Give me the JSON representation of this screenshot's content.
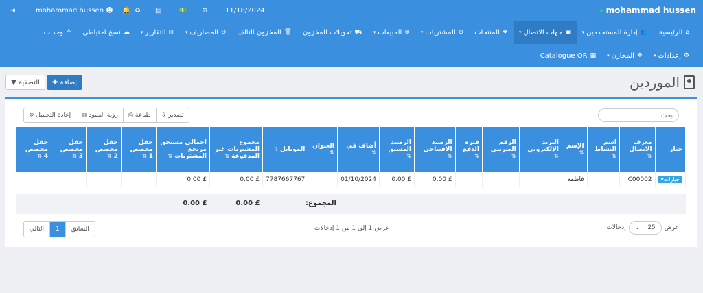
{
  "topbar": {
    "brand": "mohammad hussen",
    "date": "11/18/2024",
    "user": "mohammad hussen"
  },
  "nav_row1": [
    {
      "label": "الرئيسية",
      "icon": "⌂",
      "caret": false
    },
    {
      "label": "إدارة المستخدمين",
      "icon": "👥",
      "caret": true
    },
    {
      "label": "جهات الاتصال",
      "icon": "▣",
      "caret": true,
      "active": true
    },
    {
      "label": "المنتجات",
      "icon": "❖",
      "caret": false
    },
    {
      "label": "المشتريات",
      "icon": "⊕",
      "caret": true
    },
    {
      "label": "المبيعات",
      "icon": "⊕",
      "caret": true
    },
    {
      "label": "تحويلات المخزون",
      "icon": "⛟",
      "caret": false
    },
    {
      "label": "المخزون التالف",
      "icon": "🗑",
      "caret": false
    },
    {
      "label": "المصاريف",
      "icon": "⊖",
      "caret": true
    },
    {
      "label": "التقارير",
      "icon": "▥",
      "caret": true
    },
    {
      "label": "نسخ احتياطي",
      "icon": "☁",
      "caret": false
    },
    {
      "label": "وحدات",
      "icon": "⚘",
      "caret": false
    }
  ],
  "nav_row2": [
    {
      "label": "إعدادات",
      "icon": "⚙",
      "caret": true
    },
    {
      "label": "المخازن",
      "icon": "❖",
      "caret": true
    },
    {
      "label": "Catalogue QR",
      "icon": "▦",
      "caret": false
    }
  ],
  "page": {
    "title": "الموردين",
    "add_btn": "إضافة",
    "filter_btn": "التصفية"
  },
  "toolbar": [
    "تصدير",
    "طباعة",
    "رؤية العمود",
    "إعادة التحميل"
  ],
  "search_placeholder": "بحث ...",
  "table": {
    "headers": [
      "خيار",
      "معرف الاتصال",
      "اسم النشاط",
      "الإسم",
      "البريد الإلكتروني",
      "الرقم الضريبي",
      "فترة الدفع",
      "الرصيد الافتتاحي",
      "الرصيد المسبق",
      "أضاف في",
      "العنوان",
      "الموبايل",
      "مجموع المشتريات غير المدفوعة",
      "اجمالي مستحق مرتجع المشتريات",
      "حقل مخصص 1",
      "حقل مخصص 2",
      "حقل مخصص 3",
      "حقل مخصص 4"
    ],
    "rows": [
      {
        "action": "خيارات",
        "id": "C00002",
        "business": "",
        "name": "فاطمة",
        "email": "",
        "tax": "",
        "pay_term": "",
        "opening": "£ 0.00",
        "advance": "£ 0.00",
        "added": "01/10/2024",
        "address": "",
        "mobile": "7787667767",
        "due": "£ 0.00",
        "return_due": "£ 0.00"
      }
    ],
    "footer": {
      "label": "المجموع:",
      "due": "£ 0.00",
      "return_due": "£ 0.00"
    }
  },
  "info": "عرض 1 إلى 1 من 1 إدخالات",
  "length": {
    "prefix": "عرض",
    "value": "25",
    "suffix": "إدخالات"
  },
  "pager": [
    "السابق",
    "1",
    "التالي"
  ],
  "colors": {
    "primary": "#3a8fde",
    "dark": "#2f7cc4"
  }
}
